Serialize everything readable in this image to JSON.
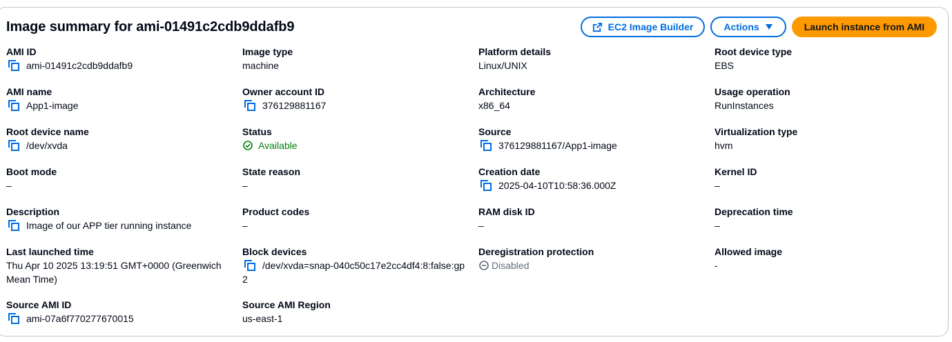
{
  "header": {
    "title": "Image summary for ami-01491c2cdb9ddafb9",
    "builder_label": "EC2 Image Builder",
    "actions_label": "Actions",
    "launch_label": "Launch instance from AMI"
  },
  "icons": {
    "copy": "copy-icon",
    "external_link": "external-link-icon",
    "caret": "caret-down-icon",
    "check": "check-circle-icon",
    "minus": "minus-circle-icon"
  },
  "colors": {
    "link_blue": "#006ce0",
    "primary_orange": "#ff9900",
    "success_green": "#037f0c",
    "disabled_gray": "#5f6b7a"
  },
  "fields": {
    "ami_id": {
      "label": "AMI ID",
      "value": "ami-01491c2cdb9ddafb9"
    },
    "image_type": {
      "label": "Image type",
      "value": "machine"
    },
    "platform_details": {
      "label": "Platform details",
      "value": "Linux/UNIX"
    },
    "root_device_type": {
      "label": "Root device type",
      "value": "EBS"
    },
    "ami_name": {
      "label": "AMI name",
      "value": "App1-image"
    },
    "owner_account_id": {
      "label": "Owner account ID",
      "value": "376129881167"
    },
    "architecture": {
      "label": "Architecture",
      "value": "x86_64"
    },
    "usage_operation": {
      "label": "Usage operation",
      "value": "RunInstances"
    },
    "root_device_name": {
      "label": "Root device name",
      "value": "/dev/xvda"
    },
    "status": {
      "label": "Status",
      "value": "Available"
    },
    "source": {
      "label": "Source",
      "value": "376129881167/App1-image"
    },
    "virtualization_type": {
      "label": "Virtualization type",
      "value": "hvm"
    },
    "boot_mode": {
      "label": "Boot mode",
      "value": "–"
    },
    "state_reason": {
      "label": "State reason",
      "value": "–"
    },
    "creation_date": {
      "label": "Creation date",
      "value": "2025-04-10T10:58:36.000Z"
    },
    "kernel_id": {
      "label": "Kernel ID",
      "value": "–"
    },
    "description": {
      "label": "Description",
      "value": "Image of our APP tier running instance"
    },
    "product_codes": {
      "label": "Product codes",
      "value": "–"
    },
    "ram_disk_id": {
      "label": "RAM disk ID",
      "value": "–"
    },
    "deprecation_time": {
      "label": "Deprecation time",
      "value": "–"
    },
    "last_launched_time": {
      "label": "Last launched time",
      "value": "Thu Apr 10 2025 13:19:51 GMT+0000 (Greenwich Mean Time)"
    },
    "block_devices": {
      "label": "Block devices",
      "value": "/dev/xvda=snap-040c50c17e2cc4df4:8:false:gp2"
    },
    "deregistration_protection": {
      "label": "Deregistration protection",
      "value": "Disabled"
    },
    "allowed_image": {
      "label": "Allowed image",
      "value": "-"
    },
    "source_ami_id": {
      "label": "Source AMI ID",
      "value": "ami-07a6f770277670015"
    },
    "source_ami_region": {
      "label": "Source AMI Region",
      "value": "us-east-1"
    }
  }
}
